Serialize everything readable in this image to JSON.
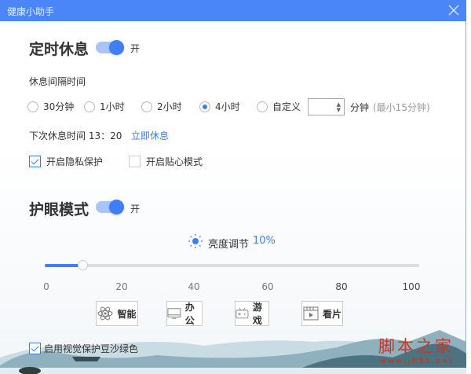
{
  "window": {
    "title": "健康小助手",
    "close_icon": "close-icon"
  },
  "rest": {
    "heading": "定时休息",
    "toggle_on": true,
    "toggle_label": "开",
    "interval_label": "休息间隔时间",
    "options": [
      {
        "label": "30分钟",
        "selected": false
      },
      {
        "label": "1小时",
        "selected": false
      },
      {
        "label": "2小时",
        "selected": false
      },
      {
        "label": "4小时",
        "selected": true
      },
      {
        "label": "自定义",
        "selected": false
      }
    ],
    "custom_value": "",
    "custom_unit": "分钟",
    "custom_hint": "(最小15分钟)",
    "next_rest": "下次休息时间 13：20",
    "rest_now": "立即休息",
    "privacy": {
      "label": "开启隐私保护",
      "checked": true
    },
    "care": {
      "label": "开启贴心模式",
      "checked": false
    }
  },
  "eye": {
    "heading": "护眼模式",
    "toggle_on": true,
    "toggle_label": "开",
    "brightness_label": "亮度调节",
    "brightness_value": "10%",
    "brightness": 10,
    "ticks": [
      "0",
      "20",
      "40",
      "60",
      "80",
      "100"
    ],
    "modes": [
      {
        "label": "智能",
        "icon": "atom-icon"
      },
      {
        "label": "办公",
        "icon": "monitor-icon"
      },
      {
        "label": "游戏",
        "icon": "gamepad-icon"
      },
      {
        "label": "看片",
        "icon": "film-icon"
      }
    ],
    "green": {
      "label": "启用视觉保护豆沙绿色",
      "checked": true
    }
  },
  "watermark": {
    "text": "脚本之家",
    "url": "www.jb51.net"
  },
  "colors": {
    "accent": "#3f7ef5",
    "titlebar": "#4a86f7",
    "watermark": "#c0392b"
  }
}
